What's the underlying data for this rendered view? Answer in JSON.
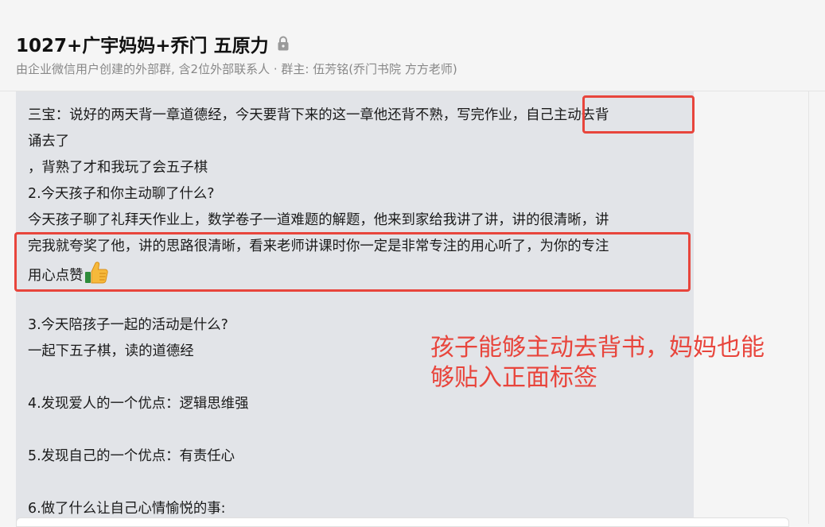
{
  "header": {
    "title": "1027+广宇妈妈+乔门 五原力",
    "subtitle": "由企业微信用户创建的外部群, 含2位外部联系人 · 群主: 伍芳铭(乔门书院 方方老师)"
  },
  "message": {
    "lines": [
      "三宝：说好的两天背一章道德经，今天要背下来的这一章他还背不熟，写完作业，自己主动去背",
      "诵去了",
      "，背熟了才和我玩了会五子棋",
      "2.今天孩子和你主动聊了什么?",
      "今天孩子聊了礼拜天作业上，数学卷子一道难题的解题，他来到家给我讲了讲，讲的很清晰，讲",
      "完我就夸奖了他，讲的思路很清晰，看来老师讲课时你一定是非常专注的用心听了，为你的专注",
      "用心点赞",
      "",
      "3.今天陪孩子一起的活动是什么?",
      "一起下五子棋，读的道德经",
      "",
      "4.发现爱人的一个优点：逻辑思维强",
      "",
      "5.发现自己的一个优点：有责任心",
      "",
      "6.做了什么让自己心情愉悦的事:"
    ]
  },
  "annotation": {
    "line1": "孩子能够主动去背书，妈妈也能",
    "line2": "够贴入正面标签"
  },
  "colors": {
    "highlight": "#e8453c",
    "bubble": "#e2e4e8",
    "background": "#f5f5f5"
  },
  "icons": {
    "lock": "lock-icon",
    "thumbs_up": "thumbs-up-icon"
  }
}
